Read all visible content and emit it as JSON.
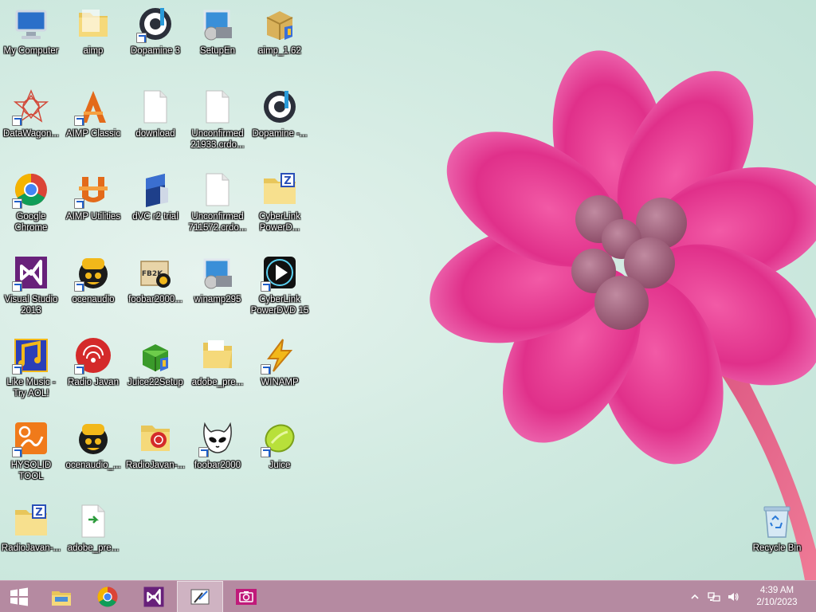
{
  "desktop": {
    "icons": [
      {
        "label": "My Computer",
        "icon": "computer-icon",
        "shortcut": false
      },
      {
        "label": "aimp",
        "icon": "folder-icon",
        "shortcut": false
      },
      {
        "label": "Dopamine 3",
        "icon": "dopamine-icon",
        "shortcut": true
      },
      {
        "label": "SetupEn",
        "icon": "installer-icon",
        "shortcut": false
      },
      {
        "label": "aimp_1.62",
        "icon": "setup-box-icon",
        "shortcut": false
      },
      {
        "label": "DataWagon...",
        "icon": "datawagon-icon",
        "shortcut": true
      },
      {
        "label": "AIMP Classic",
        "icon": "aimp-classic-icon",
        "shortcut": true
      },
      {
        "label": "download",
        "icon": "blank-file-icon",
        "shortcut": false
      },
      {
        "label": "Unconfirmed 21933.crdo...",
        "icon": "blank-file-icon",
        "shortcut": false
      },
      {
        "label": "Dopamine -...",
        "icon": "dopamine-icon",
        "shortcut": false
      },
      {
        "label": "Google Chrome",
        "icon": "chrome-icon",
        "shortcut": true
      },
      {
        "label": "AIMP Utilities",
        "icon": "aimp-utilities-icon",
        "shortcut": true
      },
      {
        "label": "dVC r2 trial",
        "icon": "dvc-icon",
        "shortcut": false
      },
      {
        "label": "Unconfirmed 711572.crdo...",
        "icon": "blank-file-icon",
        "shortcut": false
      },
      {
        "label": "CyberLink PowerD...",
        "icon": "zip-folder-icon",
        "shortcut": false
      },
      {
        "label": "Visual Studio 2013",
        "icon": "visual-studio-icon",
        "shortcut": true
      },
      {
        "label": "ocenaudio",
        "icon": "ocenaudio-icon",
        "shortcut": true
      },
      {
        "label": "foobar2000...",
        "icon": "foobar-setup-icon",
        "shortcut": false
      },
      {
        "label": "winamp295",
        "icon": "installer-icon",
        "shortcut": false
      },
      {
        "label": "CyberLink PowerDVD 15",
        "icon": "powerdvd-icon",
        "shortcut": true
      },
      {
        "label": "Like Music - Try AOL!",
        "icon": "like-music-icon",
        "shortcut": true
      },
      {
        "label": "Radio Javan",
        "icon": "radio-javan-icon",
        "shortcut": true
      },
      {
        "label": "Juice22Setup",
        "icon": "juice-setup-icon",
        "shortcut": false
      },
      {
        "label": "adobe_pre...",
        "icon": "folder-open-icon",
        "shortcut": false
      },
      {
        "label": "WINAMP",
        "icon": "winamp-icon",
        "shortcut": true
      },
      {
        "label": "HYSOLID TOOL",
        "icon": "hysolid-icon",
        "shortcut": true
      },
      {
        "label": "ocenaudio_...",
        "icon": "ocenaudio-icon",
        "shortcut": false
      },
      {
        "label": "RadioJavan-...",
        "icon": "radio-javan-folder-icon",
        "shortcut": false
      },
      {
        "label": "foobar2000",
        "icon": "foobar-icon",
        "shortcut": true
      },
      {
        "label": "Juice",
        "icon": "juice-icon",
        "shortcut": true
      },
      {
        "label": "RadioJavan-...",
        "icon": "zip-folder-icon",
        "shortcut": false
      },
      {
        "label": "adobe_pre...",
        "icon": "exe-file-icon",
        "shortcut": false
      },
      {
        "label": "Recycle Bin",
        "icon": "recycle-bin-icon",
        "shortcut": false
      }
    ]
  },
  "taskbar": {
    "buttons": [
      {
        "name": "start",
        "icon": "windows-start-icon"
      },
      {
        "name": "file-explorer",
        "icon": "file-explorer-icon"
      },
      {
        "name": "google-chrome",
        "icon": "chrome-icon"
      },
      {
        "name": "visual-studio",
        "icon": "visual-studio-icon"
      },
      {
        "name": "paint",
        "icon": "paint-icon"
      },
      {
        "name": "camera",
        "icon": "camera-icon"
      }
    ],
    "active_button": "paint",
    "tray": {
      "icons": [
        "chevron-up-icon",
        "network-icon",
        "volume-icon"
      ],
      "time": "4:39 AM",
      "date": "2/10/2023"
    },
    "color": "#b58aa1"
  }
}
